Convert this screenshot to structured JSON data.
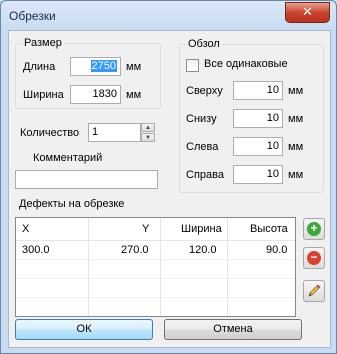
{
  "window": {
    "title": "Обрезки",
    "close_glyph": "✕"
  },
  "size_group": {
    "legend": "Размер",
    "length_label": "Длина",
    "length_value": "2750",
    "width_label": "Ширина",
    "width_value": "1830",
    "unit": "мм"
  },
  "quantity": {
    "label": "Количество",
    "value": "1"
  },
  "comment": {
    "label": "Комментарий",
    "value": ""
  },
  "trim_group": {
    "legend": "Обзол",
    "all_same_label": "Все одинаковые",
    "all_same_checked": false,
    "top_label": "Сверху",
    "top_value": "10",
    "bottom_label": "Снизу",
    "bottom_value": "10",
    "left_label": "Слева",
    "left_value": "10",
    "right_label": "Справа",
    "right_value": "10",
    "unit": "мм"
  },
  "defects": {
    "label": "Дефекты на обрезке",
    "columns": [
      "X",
      "Y",
      "Ширина",
      "Высота"
    ],
    "rows": [
      [
        "300.0",
        "270.0",
        "120.0",
        "90.0"
      ]
    ]
  },
  "side_buttons": {
    "add_icon": "add-icon",
    "remove_icon": "remove-icon",
    "edit_icon": "pencil-icon",
    "add_glyph": "+",
    "remove_glyph": "−",
    "add_color": "#3fa83a",
    "remove_color": "#d9412f"
  },
  "buttons": {
    "ok": "ОК",
    "cancel": "Отмена"
  }
}
